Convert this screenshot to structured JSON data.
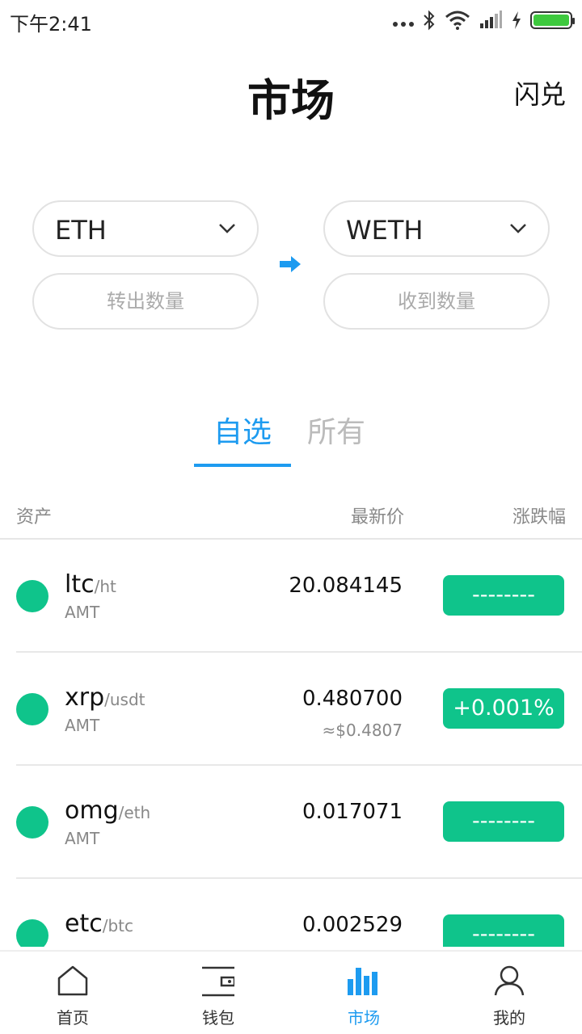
{
  "status_bar": {
    "time": "下午2:41",
    "icons": [
      "more-dots-icon",
      "bluetooth-icon",
      "wifi-icon",
      "signal-icon",
      "charging-icon",
      "battery-icon"
    ]
  },
  "header": {
    "title": "市场",
    "action_label": "闪兑"
  },
  "exchange": {
    "from_token": "ETH",
    "to_token": "WETH",
    "from_amount_placeholder": "转出数量",
    "to_amount_placeholder": "收到数量",
    "arrow_icon": "arrow-right-icon"
  },
  "tabs": [
    {
      "label": "自选",
      "active": true
    },
    {
      "label": "所有",
      "active": false
    }
  ],
  "columns": {
    "asset": "资产",
    "latest_price": "最新价",
    "change": "涨跌幅"
  },
  "rows": [
    {
      "base": "ltc",
      "quote": "/ht",
      "sub": "AMT",
      "price": "20.084145",
      "usd": "",
      "change": "--------"
    },
    {
      "base": "xrp",
      "quote": "/usdt",
      "sub": "AMT",
      "price": "0.480700",
      "usd": "≈$0.4807",
      "change": "+0.001%"
    },
    {
      "base": "omg",
      "quote": "/eth",
      "sub": "AMT",
      "price": "0.017071",
      "usd": "",
      "change": "--------"
    },
    {
      "base": "etc",
      "quote": "/btc",
      "sub": "",
      "price": "0.002529",
      "usd": "",
      "change": "--------"
    }
  ],
  "bottom_nav": [
    {
      "label": "首页",
      "icon": "home-icon",
      "active": false
    },
    {
      "label": "钱包",
      "icon": "wallet-icon",
      "active": false
    },
    {
      "label": "市场",
      "icon": "bar-chart-icon",
      "active": true
    },
    {
      "label": "我的",
      "icon": "user-icon",
      "active": false
    }
  ],
  "colors": {
    "accent": "#1d9bf0",
    "positive": "#0fc48b",
    "coin_dot": "#0fc48b"
  }
}
